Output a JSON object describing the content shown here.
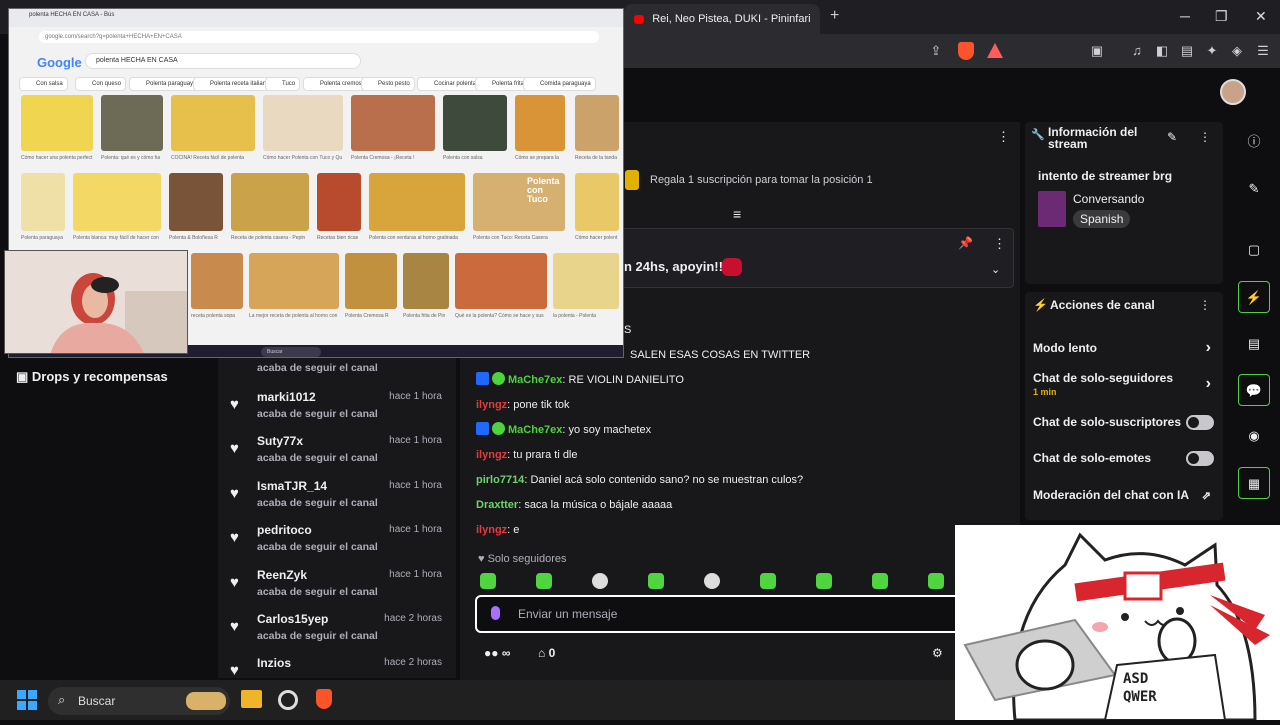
{
  "browser": {
    "tab_title": "Rei, Neo Pistea, DUKI - Pininfarina (R",
    "new_tab": "+",
    "win_min": "─",
    "win_max": "❐",
    "win_close": "✕"
  },
  "sidebar": {
    "drops_label": "Drops y recompensas"
  },
  "chat": {
    "gift_text": "Regala 1 suscripción para tomar la posición 1",
    "pinned_text": "n 24hs, apoyin!!",
    "partial_line_1": "S",
    "partial_line_2": "SALEN ESAS COSAS EN TWITTER",
    "messages": [
      {
        "user": "MaChe7ex",
        "text": "RE VIOLIN DANIELITO"
      },
      {
        "user": "ilyngz",
        "text": "pone tik tok"
      },
      {
        "user": "MaChe7ex",
        "text": "yo soy machetex"
      },
      {
        "user": "ilyngz",
        "text": "tu prara ti dle"
      },
      {
        "user": "pirlo7714",
        "text": "Daniel acá solo contenido sano? no se muestran culos?"
      },
      {
        "user": "Draxtter",
        "text": "saca la música o bájale aaaaa"
      },
      {
        "user": "ilyngz",
        "text": "e"
      }
    ],
    "followers_only": "Solo seguidores",
    "input_placeholder": "Enviar un mensaje",
    "points_value": "∞",
    "store_value": "0"
  },
  "feed": {
    "items": [
      {
        "name": "",
        "sub": "acaba de seguir el canal",
        "time": ""
      },
      {
        "name": "marki1012",
        "sub": "acaba de seguir el canal",
        "time": "hace 1 hora"
      },
      {
        "name": "Suty77x",
        "sub": "acaba de seguir el canal",
        "time": "hace 1 hora"
      },
      {
        "name": "IsmaTJR_14",
        "sub": "acaba de seguir el canal",
        "time": "hace 1 hora"
      },
      {
        "name": "pedritoco",
        "sub": "acaba de seguir el canal",
        "time": "hace 1 hora"
      },
      {
        "name": "ReenZyk",
        "sub": "acaba de seguir el canal",
        "time": "hace 1 hora"
      },
      {
        "name": "Carlos15yep",
        "sub": "acaba de seguir el canal",
        "time": "hace 2 horas"
      },
      {
        "name": "Inzios",
        "sub": "",
        "time": "hace 2 horas"
      }
    ]
  },
  "stream_info": {
    "panel_title": "Información del stream",
    "title": "intento de streamer brg",
    "category": "Conversando",
    "language": "Spanish"
  },
  "channel_actions": {
    "panel_title": "Acciones de canal",
    "slow_mode": "Modo lento",
    "followers_only": "Chat de solo-seguidores",
    "followers_only_duration": "1 min",
    "subs_only": "Chat de solo-suscriptores",
    "emotes_only": "Chat de solo-emotes",
    "ai_moderation": "Moderación del chat con IA"
  },
  "share": {
    "tab_title": "polenta HECHA EN CASA - Bús",
    "url": "google.com/search?q=polenta+HECHA+EN+CASA",
    "search_query": "polenta HECHA EN CASA",
    "logo": "Google",
    "chips": [
      "Con salsa",
      "Con queso",
      "Polenta paraguaya",
      "Polenta receta italiana",
      "Tuco",
      "Polenta cremosa",
      "Pesto pesto",
      "Cocinar polenta",
      "Polenta frita",
      "Comida paraguaya"
    ],
    "captions_row1": [
      "Cómo hacer una polenta perfect",
      "Polenta: qué es y cómo ha",
      "COCINA! Receta fácil de polenta",
      "Cómo hacer Polenta con Tuco y Qu",
      "Polenta Cremosa - ¡Receta !",
      "Polenta con salsa",
      "Cómo se prepara la",
      "Receta de la tanda"
    ],
    "captions_row2": [
      "Polenta paraguaya",
      "Polenta blanca: muy fácil de hacer con",
      "Polenta & Boloñesa R",
      "Receta de polenta casera - Pepin",
      "Recetas bien ricas",
      "Polenta con verduras al horno gratinada",
      "Polenta con Tuco: Receta Casera",
      "Cómo hacer polent"
    ],
    "captions_row3": [
      "receta polenta sopa",
      "La mejor receta de polenta al horno con",
      "Polenta Cremosa R",
      "Polenta frita de Pin",
      "Qué es la polenta? Cómo se hace y sus",
      "la polenta - Polenta"
    ],
    "overlay_text": "Polenta con Tuco",
    "search_bar_label": "Buscar"
  },
  "taskbar": {
    "search_label": "Buscar"
  },
  "colors": {
    "twitch_bg": "#0e0e10",
    "panel_bg": "#18181b",
    "accent_green": "#4ed33f",
    "accent_purple": "#a970ff",
    "user_red": "#e53b3b",
    "brave_orange": "#fb542b"
  }
}
